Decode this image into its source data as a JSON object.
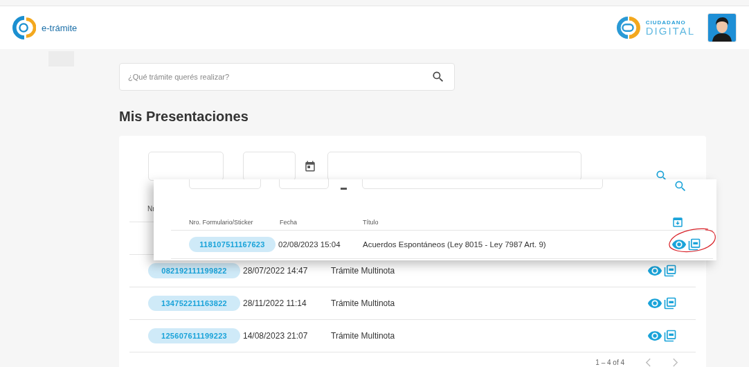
{
  "header": {
    "app_name": "e-trámite",
    "brand_top": "CIUDADANO",
    "brand_bottom": "DIGITAL"
  },
  "search": {
    "placeholder": "¿Qué trámite querés realizar?"
  },
  "title": "Mis Presentaciones",
  "table": {
    "columns": [
      "Nr"
    ],
    "rows": [
      {
        "number": "082192111199822",
        "date": "28/07/2022 14:47",
        "title": "Trámite Multinota"
      },
      {
        "number": "134752211163822",
        "date": "28/11/2022 11:14",
        "title": "Trámite Multinota"
      },
      {
        "number": "125607611199223",
        "date": "14/08/2023 21:07",
        "title": "Trámite Multinota"
      }
    ]
  },
  "pagination": {
    "range": "1 – 4 of 4"
  },
  "overlay": {
    "columns": [
      "Nro. Formulario/Sticker",
      "Fecha",
      "Título"
    ],
    "rows": [
      {
        "number": "118107511167623",
        "date": "02/08/2023 15:04",
        "title": "Acuerdos Espontáneos (Ley 8015 - Ley 7987 Art. 9)"
      }
    ]
  }
}
